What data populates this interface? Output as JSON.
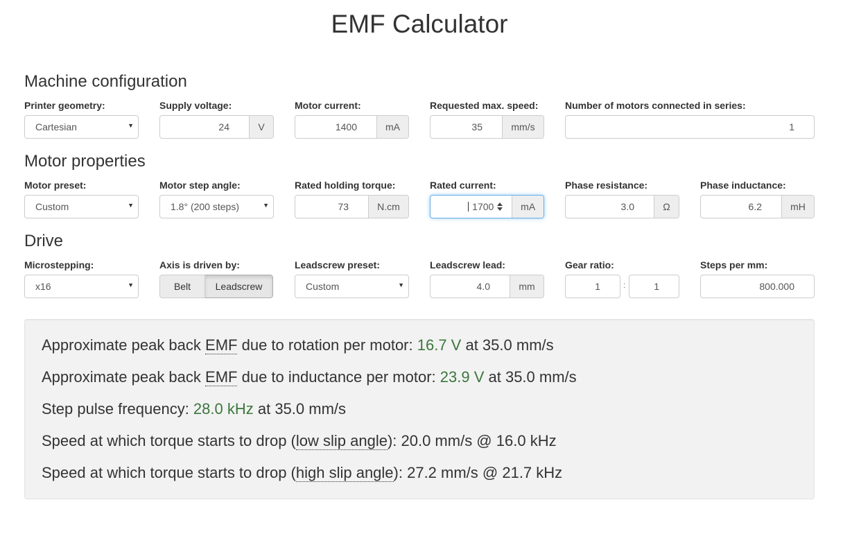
{
  "page": {
    "title": "EMF Calculator"
  },
  "sections": {
    "machine": "Machine configuration",
    "motor": "Motor properties",
    "drive": "Drive"
  },
  "machine": {
    "printer_geometry": {
      "label": "Printer geometry:",
      "value": "Cartesian"
    },
    "supply_voltage": {
      "label": "Supply voltage:",
      "value": "24",
      "unit": "V"
    },
    "motor_current": {
      "label": "Motor current:",
      "value": "1400",
      "unit": "mA"
    },
    "max_speed": {
      "label": "Requested max. speed:",
      "value": "35",
      "unit": "mm/s"
    },
    "motors_in_series": {
      "label": "Number of motors connected in series:",
      "value": "1"
    }
  },
  "motor": {
    "preset": {
      "label": "Motor preset:",
      "value": "Custom"
    },
    "step_angle": {
      "label": "Motor step angle:",
      "value": "1.8° (200 steps)"
    },
    "holding_torque": {
      "label": "Rated holding torque:",
      "value": "73",
      "unit": "N.cm"
    },
    "rated_current": {
      "label": "Rated current:",
      "value": "1700",
      "unit": "mA"
    },
    "phase_resistance": {
      "label": "Phase resistance:",
      "value": "3.0",
      "unit": "Ω"
    },
    "phase_inductance": {
      "label": "Phase inductance:",
      "value": "6.2",
      "unit": "mH"
    }
  },
  "drive": {
    "microstepping": {
      "label": "Microstepping:",
      "value": "x16"
    },
    "axis_driven_by": {
      "label": "Axis is driven by:",
      "options": [
        "Belt",
        "Leadscrew"
      ],
      "selected": "Leadscrew"
    },
    "leadscrew_preset": {
      "label": "Leadscrew preset:",
      "value": "Custom"
    },
    "leadscrew_lead": {
      "label": "Leadscrew lead:",
      "value": "4.0",
      "unit": "mm"
    },
    "gear_ratio": {
      "label": "Gear ratio:",
      "a": "1",
      "separator": ":",
      "b": "1"
    },
    "steps_per_mm": {
      "label": "Steps per mm:",
      "value": "800.000"
    }
  },
  "results": {
    "rotation": {
      "prefix": "Approximate peak back ",
      "abbr": "EMF",
      "middle": " due to rotation per motor: ",
      "value": "16.7 V",
      "suffix": " at 35.0 mm/s"
    },
    "inductance": {
      "prefix": "Approximate peak back ",
      "abbr": "EMF",
      "middle": " due to inductance per motor: ",
      "value": "23.9 V",
      "suffix": " at 35.0 mm/s"
    },
    "step_freq": {
      "prefix": "Step pulse frequency: ",
      "value": "28.0 kHz",
      "suffix": " at 35.0 mm/s"
    },
    "low_slip": {
      "prefix": "Speed at which torque starts to drop (",
      "abbr": "low slip angle",
      "suffix": "): 20.0 mm/s @ 16.0 kHz"
    },
    "high_slip": {
      "prefix": "Speed at which torque starts to drop (",
      "abbr": "high slip angle",
      "suffix": "): 27.2 mm/s @ 21.7 kHz"
    }
  },
  "colors": {
    "accent_green": "#3c763d",
    "focus_blue": "#66afe9",
    "well_bg": "#f2f2f2"
  }
}
